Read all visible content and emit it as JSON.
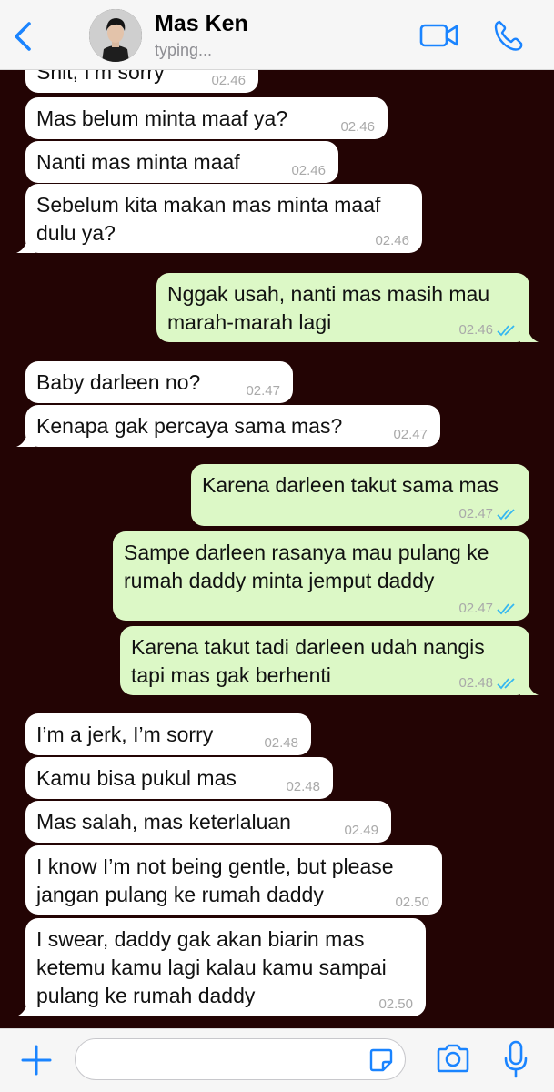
{
  "header": {
    "contact_name": "Mas Ken",
    "status": "typing...",
    "accent_color": "#1a84ff"
  },
  "messages": [
    {
      "dir": "in",
      "text": "Shit, I’m sorry",
      "time": "02.46"
    },
    {
      "dir": "in",
      "text": "Mas belum minta maaf ya?",
      "time": "02.46"
    },
    {
      "dir": "in",
      "text": "Nanti mas minta maaf",
      "time": "02.46"
    },
    {
      "dir": "in",
      "text": "Sebelum kita makan mas minta maaf dulu ya?",
      "time": "02.46"
    },
    {
      "dir": "out",
      "text": "Nggak usah, nanti mas masih mau marah-marah lagi",
      "time": "02.46",
      "read": true
    },
    {
      "dir": "in",
      "text": "Baby darleen no?",
      "time": "02.47"
    },
    {
      "dir": "in",
      "text": "Kenapa gak percaya sama mas?",
      "time": "02.47"
    },
    {
      "dir": "out",
      "text": "Karena darleen takut sama mas",
      "time": "02.47",
      "read": true
    },
    {
      "dir": "out",
      "text": "Sampe darleen rasanya mau pulang ke rumah daddy minta jemput daddy",
      "time": "02.47",
      "read": true
    },
    {
      "dir": "out",
      "text": "Karena takut tadi darleen udah nangis tapi mas gak berhenti",
      "time": "02.48",
      "read": true
    },
    {
      "dir": "in",
      "text": "I’m a jerk, I’m sorry",
      "time": "02.48"
    },
    {
      "dir": "in",
      "text": "Kamu bisa pukul mas",
      "time": "02.48"
    },
    {
      "dir": "in",
      "text": "Mas salah, mas keterlaluan",
      "time": "02.49"
    },
    {
      "dir": "in",
      "text": "I know I’m not being gentle, but please jangan pulang ke rumah daddy",
      "time": "02.50"
    },
    {
      "dir": "in",
      "text": "I swear, daddy gak akan biarin mas ketemu kamu lagi kalau kamu sampai pulang ke rumah daddy",
      "time": "02.50"
    }
  ],
  "icons": {
    "back": "chevron-left-icon",
    "video": "video-camera-icon",
    "phone": "phone-icon",
    "plus": "plus-icon",
    "sticker": "sticker-icon",
    "camera": "camera-icon",
    "mic": "microphone-icon"
  },
  "colors": {
    "chat_background": "#230404",
    "incoming_bubble": "#ffffff",
    "outgoing_bubble": "#dcf8c6",
    "read_ticks": "#34b7f1"
  }
}
